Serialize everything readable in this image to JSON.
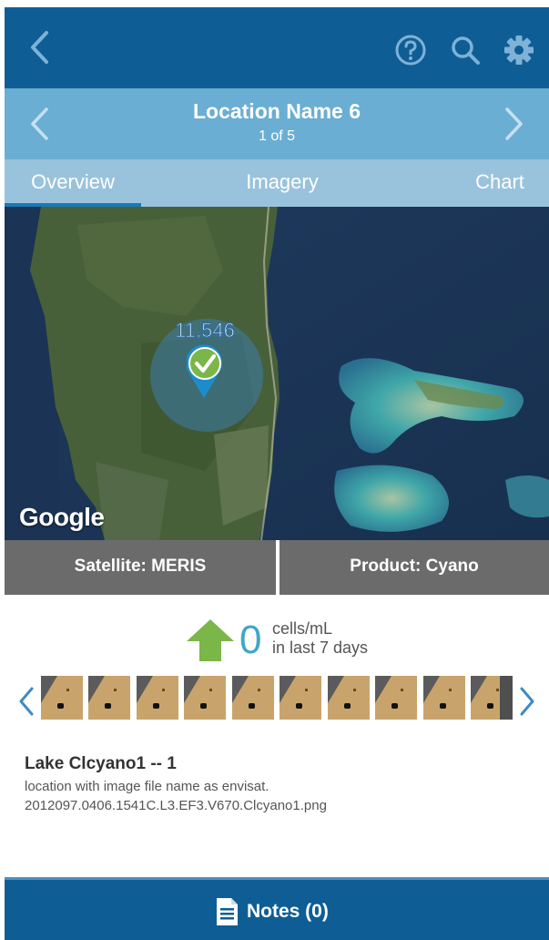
{
  "header": {
    "back_icon": "chevron-left-icon",
    "help_icon": "help-circle-icon",
    "search_icon": "search-icon",
    "settings_icon": "gear-icon",
    "color": "#0e5e95"
  },
  "location": {
    "name": "Location Name 6",
    "counter": "1 of 5",
    "color": "#6aaed3"
  },
  "tabs": [
    {
      "label": "Overview",
      "active": true
    },
    {
      "label": "Imagery",
      "active": false
    },
    {
      "label": "Chart",
      "active": false
    }
  ],
  "map": {
    "marker_count": "11,546",
    "marker_icon": "check-circle-icon",
    "attribution": "Google"
  },
  "info": {
    "satellite": "Satellite: MERIS",
    "product": "Product: Cyano"
  },
  "stat": {
    "trend_icon": "arrow-up-icon",
    "trend_color": "#7ab648",
    "value": "0",
    "unit": "cells/mL",
    "period": "in last 7 days"
  },
  "thumbnails": {
    "count": 10,
    "prev_icon": "chevron-left-icon",
    "next_icon": "chevron-right-icon"
  },
  "description": {
    "title": "Lake Clcyano1 -- 1",
    "line1": "location with image file name as envisat.",
    "line2": "2012097.0406.1541C.L3.EF3.V670.Clcyano1.png"
  },
  "notes": {
    "icon": "document-icon",
    "label": "Notes (0)"
  }
}
